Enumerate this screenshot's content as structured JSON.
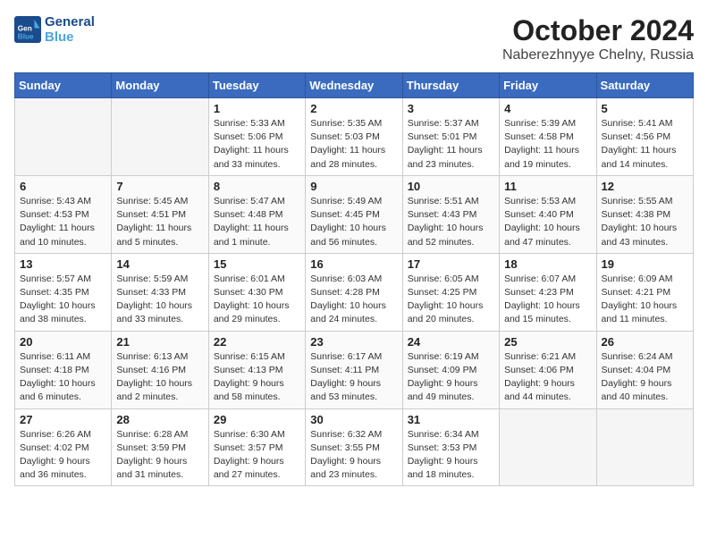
{
  "header": {
    "logo_line1": "General",
    "logo_line2": "Blue",
    "month": "October 2024",
    "location": "Naberezhnyye Chelny, Russia"
  },
  "days_of_week": [
    "Sunday",
    "Monday",
    "Tuesday",
    "Wednesday",
    "Thursday",
    "Friday",
    "Saturday"
  ],
  "weeks": [
    [
      {
        "day": "",
        "info": ""
      },
      {
        "day": "",
        "info": ""
      },
      {
        "day": "1",
        "info": "Sunrise: 5:33 AM\nSunset: 5:06 PM\nDaylight: 11 hours\nand 33 minutes."
      },
      {
        "day": "2",
        "info": "Sunrise: 5:35 AM\nSunset: 5:03 PM\nDaylight: 11 hours\nand 28 minutes."
      },
      {
        "day": "3",
        "info": "Sunrise: 5:37 AM\nSunset: 5:01 PM\nDaylight: 11 hours\nand 23 minutes."
      },
      {
        "day": "4",
        "info": "Sunrise: 5:39 AM\nSunset: 4:58 PM\nDaylight: 11 hours\nand 19 minutes."
      },
      {
        "day": "5",
        "info": "Sunrise: 5:41 AM\nSunset: 4:56 PM\nDaylight: 11 hours\nand 14 minutes."
      }
    ],
    [
      {
        "day": "6",
        "info": "Sunrise: 5:43 AM\nSunset: 4:53 PM\nDaylight: 11 hours\nand 10 minutes."
      },
      {
        "day": "7",
        "info": "Sunrise: 5:45 AM\nSunset: 4:51 PM\nDaylight: 11 hours\nand 5 minutes."
      },
      {
        "day": "8",
        "info": "Sunrise: 5:47 AM\nSunset: 4:48 PM\nDaylight: 11 hours\nand 1 minute."
      },
      {
        "day": "9",
        "info": "Sunrise: 5:49 AM\nSunset: 4:45 PM\nDaylight: 10 hours\nand 56 minutes."
      },
      {
        "day": "10",
        "info": "Sunrise: 5:51 AM\nSunset: 4:43 PM\nDaylight: 10 hours\nand 52 minutes."
      },
      {
        "day": "11",
        "info": "Sunrise: 5:53 AM\nSunset: 4:40 PM\nDaylight: 10 hours\nand 47 minutes."
      },
      {
        "day": "12",
        "info": "Sunrise: 5:55 AM\nSunset: 4:38 PM\nDaylight: 10 hours\nand 43 minutes."
      }
    ],
    [
      {
        "day": "13",
        "info": "Sunrise: 5:57 AM\nSunset: 4:35 PM\nDaylight: 10 hours\nand 38 minutes."
      },
      {
        "day": "14",
        "info": "Sunrise: 5:59 AM\nSunset: 4:33 PM\nDaylight: 10 hours\nand 33 minutes."
      },
      {
        "day": "15",
        "info": "Sunrise: 6:01 AM\nSunset: 4:30 PM\nDaylight: 10 hours\nand 29 minutes."
      },
      {
        "day": "16",
        "info": "Sunrise: 6:03 AM\nSunset: 4:28 PM\nDaylight: 10 hours\nand 24 minutes."
      },
      {
        "day": "17",
        "info": "Sunrise: 6:05 AM\nSunset: 4:25 PM\nDaylight: 10 hours\nand 20 minutes."
      },
      {
        "day": "18",
        "info": "Sunrise: 6:07 AM\nSunset: 4:23 PM\nDaylight: 10 hours\nand 15 minutes."
      },
      {
        "day": "19",
        "info": "Sunrise: 6:09 AM\nSunset: 4:21 PM\nDaylight: 10 hours\nand 11 minutes."
      }
    ],
    [
      {
        "day": "20",
        "info": "Sunrise: 6:11 AM\nSunset: 4:18 PM\nDaylight: 10 hours\nand 6 minutes."
      },
      {
        "day": "21",
        "info": "Sunrise: 6:13 AM\nSunset: 4:16 PM\nDaylight: 10 hours\nand 2 minutes."
      },
      {
        "day": "22",
        "info": "Sunrise: 6:15 AM\nSunset: 4:13 PM\nDaylight: 9 hours\nand 58 minutes."
      },
      {
        "day": "23",
        "info": "Sunrise: 6:17 AM\nSunset: 4:11 PM\nDaylight: 9 hours\nand 53 minutes."
      },
      {
        "day": "24",
        "info": "Sunrise: 6:19 AM\nSunset: 4:09 PM\nDaylight: 9 hours\nand 49 minutes."
      },
      {
        "day": "25",
        "info": "Sunrise: 6:21 AM\nSunset: 4:06 PM\nDaylight: 9 hours\nand 44 minutes."
      },
      {
        "day": "26",
        "info": "Sunrise: 6:24 AM\nSunset: 4:04 PM\nDaylight: 9 hours\nand 40 minutes."
      }
    ],
    [
      {
        "day": "27",
        "info": "Sunrise: 6:26 AM\nSunset: 4:02 PM\nDaylight: 9 hours\nand 36 minutes."
      },
      {
        "day": "28",
        "info": "Sunrise: 6:28 AM\nSunset: 3:59 PM\nDaylight: 9 hours\nand 31 minutes."
      },
      {
        "day": "29",
        "info": "Sunrise: 6:30 AM\nSunset: 3:57 PM\nDaylight: 9 hours\nand 27 minutes."
      },
      {
        "day": "30",
        "info": "Sunrise: 6:32 AM\nSunset: 3:55 PM\nDaylight: 9 hours\nand 23 minutes."
      },
      {
        "day": "31",
        "info": "Sunrise: 6:34 AM\nSunset: 3:53 PM\nDaylight: 9 hours\nand 18 minutes."
      },
      {
        "day": "",
        "info": ""
      },
      {
        "day": "",
        "info": ""
      }
    ]
  ]
}
